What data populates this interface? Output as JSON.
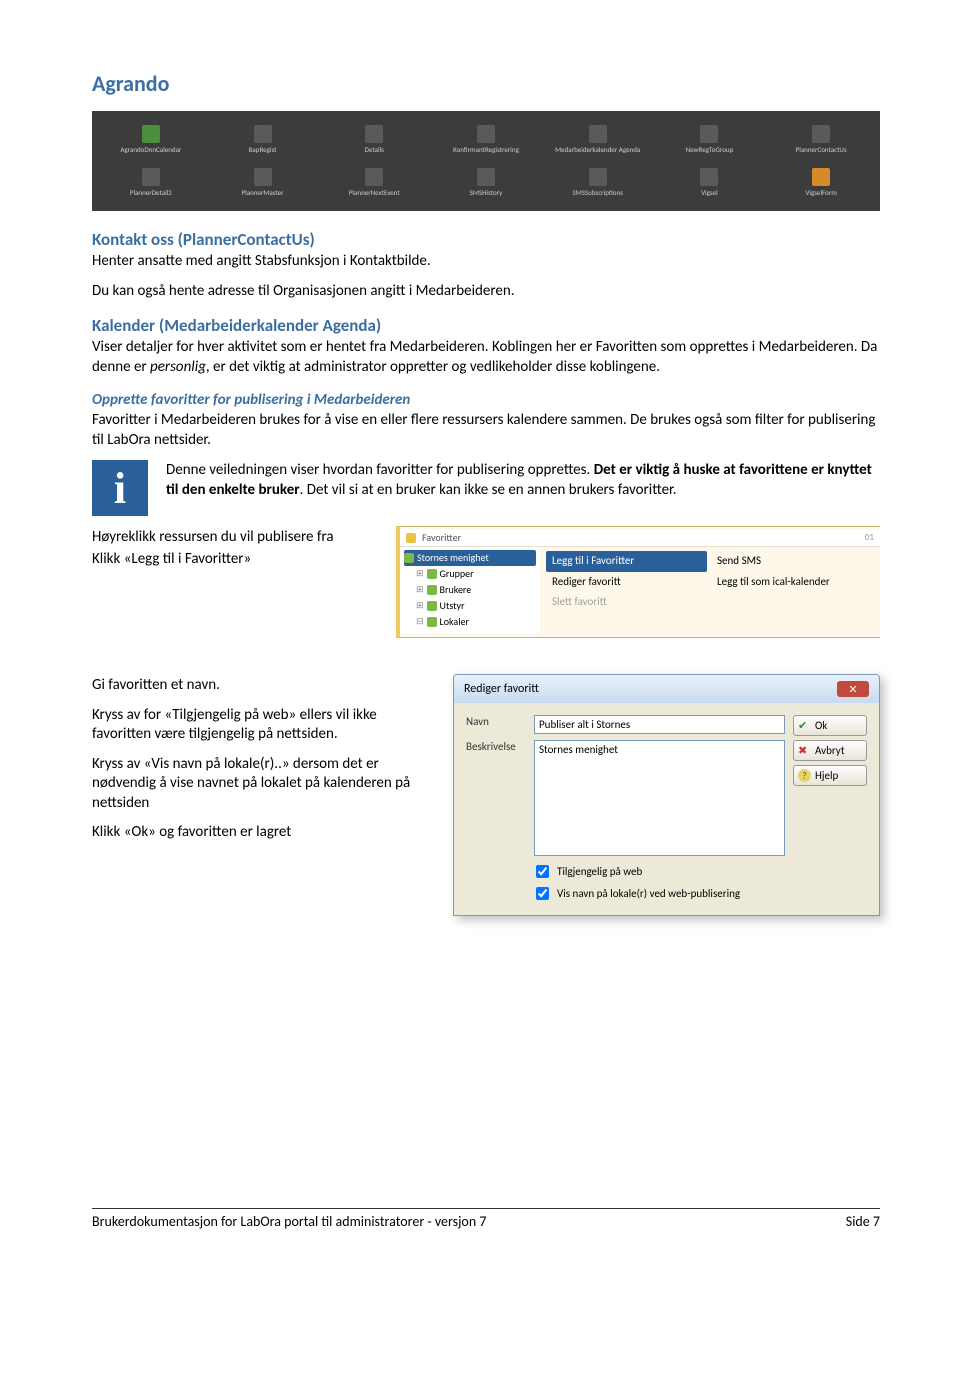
{
  "brand": "Agrando",
  "toolbar": {
    "row1": [
      {
        "label": "AgrandoDnnCalendar",
        "icon": "green"
      },
      {
        "label": "BapRegist",
        "icon": "dark"
      },
      {
        "label": "Details",
        "icon": "dark"
      },
      {
        "label": "KonfirmantRegistrering",
        "icon": "dark"
      },
      {
        "label": "Medarbeiderkalender Agenda",
        "icon": "dark"
      },
      {
        "label": "NewRegToGroup",
        "icon": "dark"
      },
      {
        "label": "PlannerContactUs",
        "icon": "dark"
      }
    ],
    "row2": [
      {
        "label": "PlannerDetail2",
        "icon": "dark"
      },
      {
        "label": "PlannerMaster",
        "icon": "dark"
      },
      {
        "label": "PlannerNextEvent",
        "icon": "dark"
      },
      {
        "label": "SMSHistory",
        "icon": "dark"
      },
      {
        "label": "SMSSubscriptions",
        "icon": "dark"
      },
      {
        "label": "Vigsel",
        "icon": "dark"
      },
      {
        "label": "VigselForm",
        "icon": "orange"
      }
    ]
  },
  "sections": {
    "s1": {
      "title": "Kontakt oss (PlannerContactUs)",
      "p1": "Henter ansatte med angitt Stabsfunksjon i Kontaktbilde.",
      "p2": "Du kan også hente adresse til Organisasjonen angitt i Medarbeideren."
    },
    "s2": {
      "title": "Kalender (Medarbeiderkalender Agenda)",
      "p1a": "Viser detaljer for hver aktivitet som er hentet fra Medarbeideren. Koblingen her er Favoritten som opprettes i Medarbeideren. Da denne er ",
      "p1italic": "personlig",
      "p1b": ", er det viktig at administrator oppretter og vedlikeholder disse koblingene."
    },
    "s3": {
      "title": "Opprette favoritter for publisering i Medarbeideren",
      "p1": "Favoritter i Medarbeideren brukes for å vise en eller flere ressursers kalendere sammen. De brukes også som filter for publisering til LabOra nettsider."
    },
    "info": {
      "a": "Denne veiledningen viser hvordan favoritter for publisering opprettes. ",
      "b": "Det er viktig å huske at favorittene er knyttet til den enkelte bruker",
      "c": ". Det vil si at en bruker kan ikke se en annen brukers favoritter."
    },
    "instr1a": "Høyreklikk ressursen du vil publisere fra",
    "instr1b": "Klikk «Legg til i Favoritter»",
    "instr2a": "Gi favoritten et navn.",
    "instr2b": "Kryss av for «Tilgjengelig på web» ellers vil ikke favoritten være tilgjengelig på nettsiden.",
    "instr2c": "Kryss av «Vis navn på lokale(r)..» dersom det er nødvendig å vise navnet på lokalet på kalenderen på nettsiden",
    "instr2d": "Klikk «Ok» og favoritten er lagret"
  },
  "ctxmenu": {
    "topFavoritter": "Favoritter",
    "tree": [
      {
        "label": "Stornes menighet",
        "selected": true
      },
      {
        "label": "Grupper"
      },
      {
        "label": "Brukere"
      },
      {
        "label": "Utstyr"
      },
      {
        "label": "Lokaler"
      }
    ],
    "col1": [
      {
        "label": "Legg til i Favoritter",
        "hl": true
      },
      {
        "label": "Rediger favoritt"
      },
      {
        "label": "Slett favoritt",
        "disabled": true
      }
    ],
    "col2": [
      {
        "label": "Send SMS"
      },
      {
        "label": "Legg til som ical-kalender"
      }
    ]
  },
  "dialog": {
    "title": "Rediger favoritt",
    "labelNavn": "Navn",
    "valueNavn": "Publiser alt i Stornes",
    "labelBeskrivelse": "Beskrivelse",
    "valueBeskrivelse": "Stornes menighet",
    "chk1": "Tilgjengelig på web",
    "chk2": "Vis navn på lokale(r) ved web-publisering",
    "btnOk": "Ok",
    "btnAvbryt": "Avbryt",
    "btnHjelp": "Hjelp"
  },
  "footer": {
    "left": "Brukerdokumentasjon for LabOra portal til administratorer - versjon 7",
    "right": "Side 7"
  }
}
